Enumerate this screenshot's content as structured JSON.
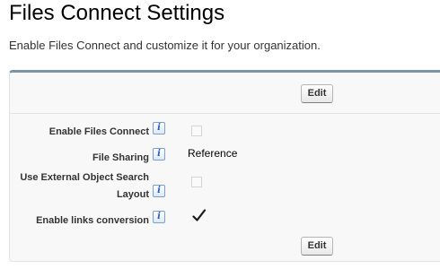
{
  "page": {
    "title": "Files Connect Settings",
    "description": "Enable Files Connect and customize it for your organization."
  },
  "buttons": {
    "edit_top": "Edit",
    "edit_bottom": "Edit"
  },
  "fields": [
    {
      "label": "Enable Files Connect",
      "help_icon": "i",
      "type": "checkbox",
      "checked": false
    },
    {
      "label": "File Sharing",
      "help_icon": "i",
      "type": "text",
      "value": "Reference"
    },
    {
      "label_line1": "Use External Object Search",
      "label_line2": "Layout",
      "help_icon": "i",
      "type": "checkbox",
      "checked": false
    },
    {
      "label": "Enable links conversion",
      "help_icon": "i",
      "type": "checkbox",
      "checked": true
    }
  ],
  "colors": {
    "panel_top_border": "#7d93a8",
    "panel_background": "#f8f8f8",
    "help_icon_blue": "#2a5db0"
  }
}
